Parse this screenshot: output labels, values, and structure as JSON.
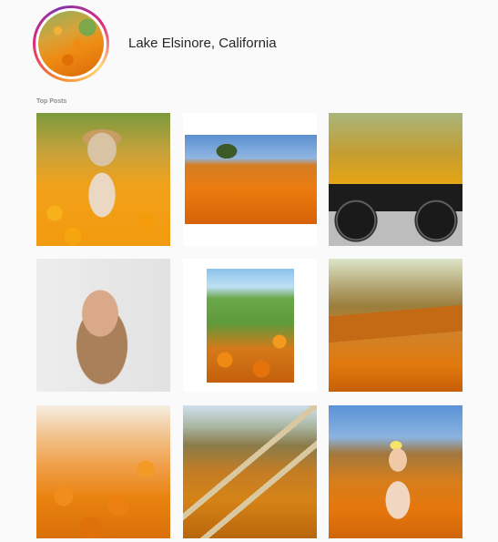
{
  "header": {
    "location": "Lake Elsinore, California"
  },
  "section": {
    "label": "Top Posts"
  },
  "posts": [
    {
      "name": "post-woman-in-poppies-hat"
    },
    {
      "name": "post-poppy-field-tree"
    },
    {
      "name": "post-motorcycle-poppy-hills"
    },
    {
      "name": "post-woman-dreadlocks-portrait"
    },
    {
      "name": "post-poppy-hillside-vertical"
    },
    {
      "name": "post-poppy-valley-hills"
    },
    {
      "name": "post-poppy-closeup"
    },
    {
      "name": "post-winding-trail-poppies"
    },
    {
      "name": "post-woman-yellow-bow-poppies"
    }
  ],
  "colors": {
    "background": "#fafafa",
    "text": "#262626",
    "muted": "#8e8e8e",
    "ring_gradient": [
      "#f58529",
      "#dd2a7b",
      "#8134af",
      "#feda77"
    ]
  }
}
